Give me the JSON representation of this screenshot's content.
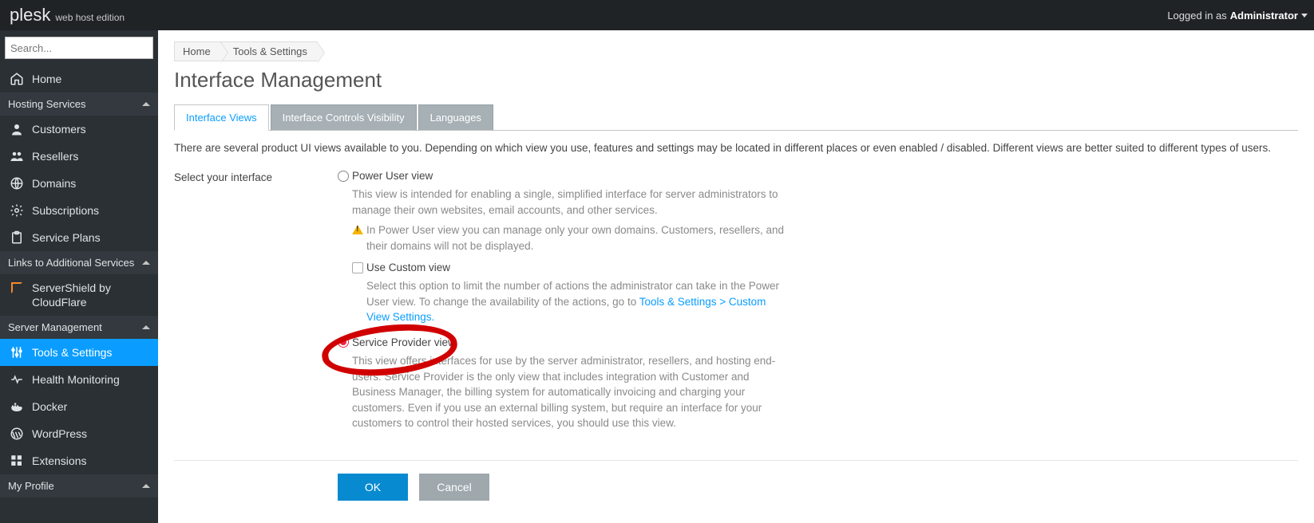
{
  "header": {
    "brand": "plesk",
    "edition": "web host edition",
    "logged_in_as_label": "Logged in as",
    "user": "Administrator"
  },
  "search": {
    "placeholder": "Search..."
  },
  "sidebar": {
    "home": "Home",
    "groups": {
      "hosting": {
        "title": "Hosting Services",
        "items": [
          "Customers",
          "Resellers",
          "Domains",
          "Subscriptions",
          "Service Plans"
        ]
      },
      "links": {
        "title": "Links to Additional Services",
        "items": [
          "ServerShield by CloudFlare"
        ]
      },
      "server": {
        "title": "Server Management",
        "items": [
          "Tools & Settings",
          "Health Monitoring",
          "Docker",
          "WordPress",
          "Extensions"
        ]
      },
      "profile": {
        "title": "My Profile"
      }
    }
  },
  "breadcrumbs": [
    "Home",
    "Tools & Settings"
  ],
  "page": {
    "title": "Interface Management",
    "tabs": [
      "Interface Views",
      "Interface Controls Visibility",
      "Languages"
    ],
    "intro": "There are several product UI views available to you. Depending on which view you use, features and settings may be located in different places or even enabled / disabled. Different views are better suited to different types of users.",
    "select_label": "Select your interface",
    "options": {
      "power_user": {
        "label": "Power User view",
        "desc": "This view is intended for enabling a single, simplified interface for server administrators to manage their own websites, email accounts, and other services.",
        "warn": "In Power User view you can manage only your own domains. Customers, resellers, and their domains will not be displayed.",
        "custom_label": "Use Custom view",
        "custom_desc_a": "Select this option to limit the number of actions the administrator can take in the Power User view. To change the availability of the actions, go to ",
        "custom_link": "Tools & Settings > Custom View Settings.",
        "custom_desc_b": ""
      },
      "service_provider": {
        "label": "Service Provider view",
        "desc": "This view offers interfaces for use by the server administrator, resellers, and hosting end-users. Service Provider is the only view that includes integration with Customer and Business Manager, the billing system for automatically invoicing and charging your customers. Even if you use an external billing system, but require an interface for your customers to control their hosted services, you should use this view."
      }
    },
    "buttons": {
      "ok": "OK",
      "cancel": "Cancel"
    }
  }
}
